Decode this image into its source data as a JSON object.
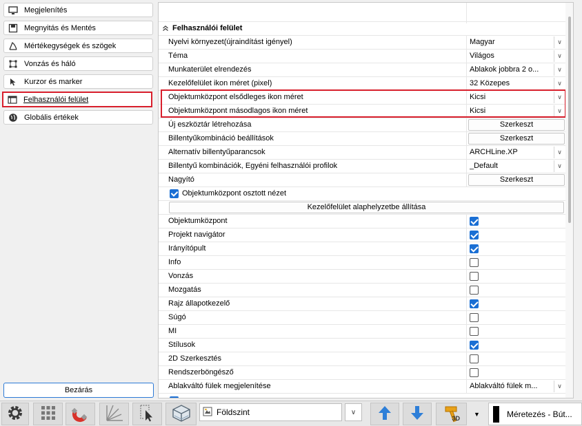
{
  "sidebar": {
    "items": [
      {
        "label": "Megjelenítés",
        "icon": "monitor-icon"
      },
      {
        "label": "Megnyitás és Mentés",
        "icon": "save-icon"
      },
      {
        "label": "Mértékegységek és szögek",
        "icon": "angle-icon"
      },
      {
        "label": "Vonzás és háló",
        "icon": "snap-grid-icon"
      },
      {
        "label": "Kurzor és marker",
        "icon": "cursor-icon"
      },
      {
        "label": "Felhasználói felület",
        "icon": "window-icon"
      },
      {
        "label": "Globális értékek",
        "icon": "globe-icon"
      }
    ],
    "active_index": 5,
    "close_label": "Bezárás"
  },
  "panel": {
    "section_title": "Felhasználói felület",
    "settings": [
      {
        "name": "Nyelvi környezet(újraindítást igényel)",
        "type": "combo",
        "value": "Magyar"
      },
      {
        "name": "Téma",
        "type": "combo",
        "value": "Világos"
      },
      {
        "name": "Munkaterület elrendezés",
        "type": "combo",
        "value": "Ablakok jobbra 2 o..."
      },
      {
        "name": "Kezelőfelület ikon méret (pixel)",
        "type": "combo",
        "value": "32 Közepes"
      },
      {
        "name": "Objektumközpont elsődleges ikon méret",
        "type": "combo",
        "value": "Kicsi"
      },
      {
        "name": "Objektumközpont másodlagos ikon méret",
        "type": "combo",
        "value": "Kicsi"
      },
      {
        "name": "Új eszköztár létrehozása",
        "type": "button",
        "value": "Szerkeszt"
      },
      {
        "name": "Billentyűkombináció beállítások",
        "type": "button",
        "value": "Szerkeszt"
      },
      {
        "name": "Alternatív billentyűparancsok",
        "type": "combo",
        "value": "ARCHLine.XP"
      },
      {
        "name": "Billentyű kombinációk, Egyéni felhasználói profilok",
        "type": "combo",
        "value": "_Default"
      },
      {
        "name": "Nagyító",
        "type": "button",
        "value": "Szerkeszt"
      }
    ],
    "split_view": {
      "label": "Objektumközpont osztott nézet",
      "checked": true
    },
    "reset_button": "Kezelőfelület alaphelyzetbe állítása",
    "toggles": [
      {
        "name": "Objektumközpont",
        "checked": true
      },
      {
        "name": "Projekt navigátor",
        "checked": true
      },
      {
        "name": "Irányítópult",
        "checked": true
      },
      {
        "name": "Info",
        "checked": false
      },
      {
        "name": "Vonzás",
        "checked": false
      },
      {
        "name": "Mozgatás",
        "checked": false
      },
      {
        "name": "Rajz állapotkezelő",
        "checked": true
      },
      {
        "name": "Súgó",
        "checked": false
      },
      {
        "name": "MI",
        "checked": false
      },
      {
        "name": "Stílusok",
        "checked": true
      },
      {
        "name": "2D Szerkesztés",
        "checked": false
      },
      {
        "name": "Rendszerböngésző",
        "checked": false
      }
    ],
    "last_setting": {
      "name": "Ablakváltó fülek megjelenítése",
      "value": "Ablakváltó fülek m..."
    }
  },
  "toolbar": {
    "level": "Földszint",
    "measure": "Méretezés - Bút...",
    "icons": [
      "settings-icon",
      "grid-icon",
      "magnet-icon",
      "angle-snap-icon",
      "select-cursor-icon",
      "3d-box-icon",
      "arrow-up-icon",
      "arrow-down-icon",
      "hammer-3d-icon",
      "dropdown-icon"
    ],
    "hammer_label": "3D"
  },
  "colors": {
    "highlight": "#d81e2b",
    "checkbox": "#1a6fd4",
    "close_border": "#2b79d6",
    "arrow_blue": "#2e7fd8"
  }
}
